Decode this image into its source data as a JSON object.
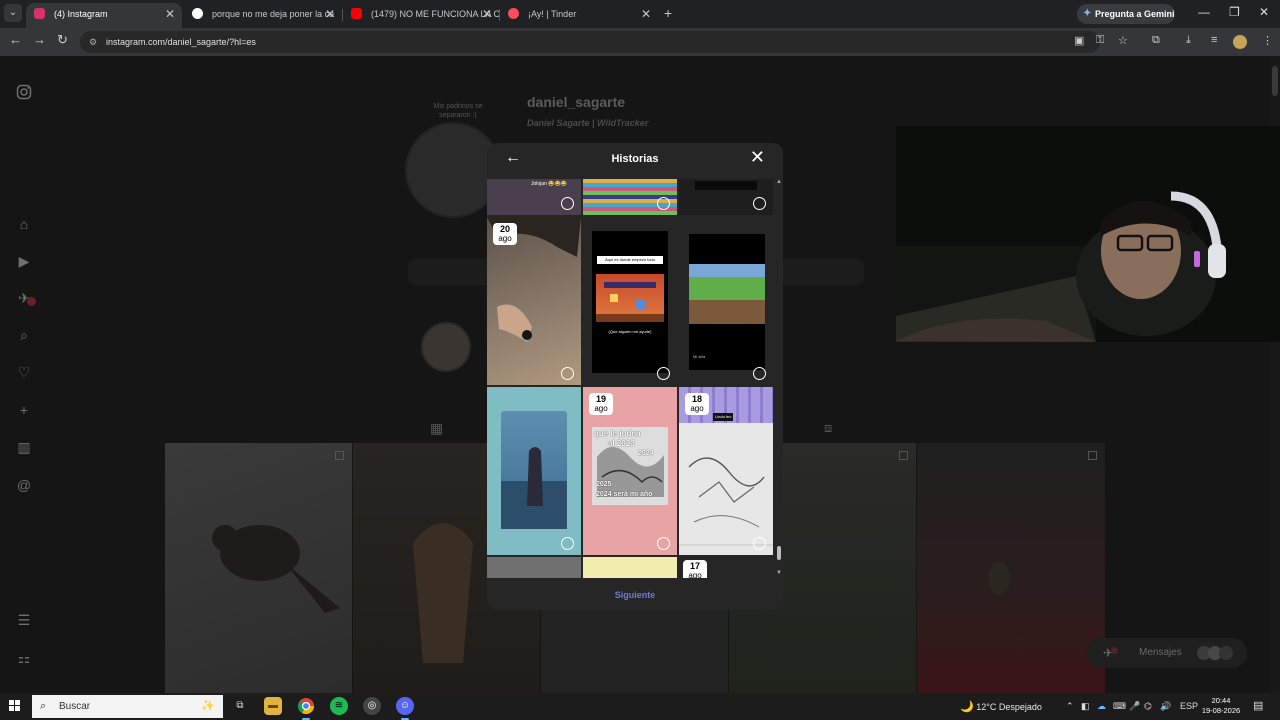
{
  "browser": {
    "tabs": [
      {
        "title": "(4) Instagram",
        "favicon_color": "#d6336c",
        "active": true
      },
      {
        "title": "porque no me deja poner la ca",
        "favicon_color": "#ffffff",
        "active": false
      },
      {
        "title": "(1479) NO ME FUNCIONA LA C",
        "favicon_color": "#ff0000",
        "active": false
      },
      {
        "title": "¡Ay! | Tinder",
        "favicon_color": "#fd4c5c",
        "active": false
      }
    ],
    "new_tab_label": "+",
    "gemini_label": "Pregunta a Gemini",
    "url": "instagram.com/daniel_sagarte/?hl=es"
  },
  "profile": {
    "username": "daniel_sagarte",
    "subtitle": "Daniel Sagarte | WildTracker",
    "note": "Mis padrinos se separaron :(",
    "nav_badge_count": "4"
  },
  "modal": {
    "title": "Historias",
    "next_label": "Siguiente",
    "cells": [
      {
        "id": "r0c0",
        "caption": "Jolojan 😂😂😂"
      },
      {
        "id": "r0c1",
        "caption": ""
      },
      {
        "id": "r0c2",
        "caption": ""
      },
      {
        "id": "r1c0",
        "date_day": "20",
        "date_month": "ago"
      },
      {
        "id": "r1c1",
        "top_text": "Aquí es donde empezó todo",
        "bottom_text": "(Que alguien me ayude)"
      },
      {
        "id": "r1c2",
        "bottom_text": "Mi silla"
      },
      {
        "id": "r2c0"
      },
      {
        "id": "r2c1",
        "date_day": "19",
        "date_month": "ago",
        "line1": "que le joden",
        "line2": "al 2023",
        "line3": "2024",
        "line4": "2025",
        "line5": "2024 será mi año"
      },
      {
        "id": "r2c2",
        "date_day": "18",
        "date_month": "ago",
        "tag": "Lindo feo"
      },
      {
        "id": "r3c2",
        "date_day": "17",
        "date_month": "ago"
      }
    ]
  },
  "messages": {
    "label": "Mensajes"
  },
  "taskbar": {
    "search_placeholder": "Buscar",
    "weather": "12°C  Despejado",
    "lang": "ESP",
    "time": "20:44",
    "date": "19-08-2026"
  },
  "colors": {
    "accent": "#6e7bd6",
    "modal_bg": "#262626"
  }
}
